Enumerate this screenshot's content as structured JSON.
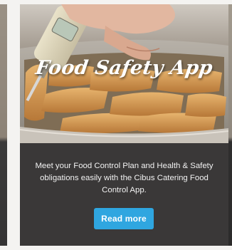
{
  "card": {
    "title": "Food Safety App",
    "description": "Meet your Food Control Plan and Health & Safety obligations easily with the Cibus Catering Food Control App.",
    "button_label": "Read more",
    "colors": {
      "card_background": "#3a3838",
      "button": "#2fa6e0",
      "text": "#ffffff"
    }
  },
  "image": {
    "icon": "thermometer-probe-food-photo"
  }
}
